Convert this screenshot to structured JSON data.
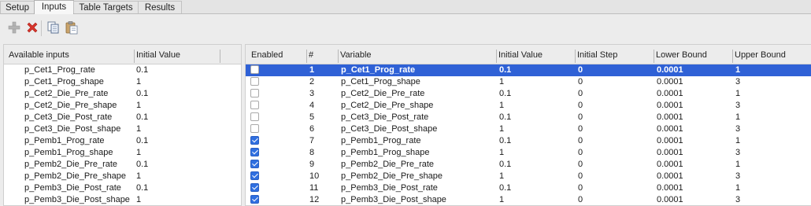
{
  "tabs": [
    "Setup",
    "Inputs",
    "Table Targets",
    "Results"
  ],
  "active_tab": "Inputs",
  "toolbar": {
    "icons": [
      "add-icon",
      "delete-icon",
      "copy-icon",
      "paste-icon"
    ]
  },
  "left_table": {
    "headers": [
      "Available inputs",
      "Initial Value",
      ""
    ],
    "rows": [
      {
        "name": "p_Cet1_Prog_rate",
        "value": "0.1"
      },
      {
        "name": "p_Cet1_Prog_shape",
        "value": "1"
      },
      {
        "name": "p_Cet2_Die_Pre_rate",
        "value": "0.1"
      },
      {
        "name": "p_Cet2_Die_Pre_shape",
        "value": "1"
      },
      {
        "name": "p_Cet3_Die_Post_rate",
        "value": "0.1"
      },
      {
        "name": "p_Cet3_Die_Post_shape",
        "value": "1"
      },
      {
        "name": "p_Pemb1_Prog_rate",
        "value": "0.1"
      },
      {
        "name": "p_Pemb1_Prog_shape",
        "value": "1"
      },
      {
        "name": "p_Pemb2_Die_Pre_rate",
        "value": "0.1"
      },
      {
        "name": "p_Pemb2_Die_Pre_shape",
        "value": "1"
      },
      {
        "name": "p_Pemb3_Die_Post_rate",
        "value": "0.1"
      },
      {
        "name": "p_Pemb3_Die_Post_shape",
        "value": "1"
      }
    ]
  },
  "right_table": {
    "headers": [
      "Enabled",
      "#",
      "Variable",
      "Initial Value",
      "Initial Step",
      "Lower Bound",
      "Upper Bound"
    ],
    "rows": [
      {
        "enabled": false,
        "num": "1",
        "variable": "p_Cet1_Prog_rate",
        "initial": "0.1",
        "step": "0",
        "lower": "0.0001",
        "upper": "1",
        "selected": true
      },
      {
        "enabled": false,
        "num": "2",
        "variable": "p_Cet1_Prog_shape",
        "initial": "1",
        "step": "0",
        "lower": "0.0001",
        "upper": "3"
      },
      {
        "enabled": false,
        "num": "3",
        "variable": "p_Cet2_Die_Pre_rate",
        "initial": "0.1",
        "step": "0",
        "lower": "0.0001",
        "upper": "1"
      },
      {
        "enabled": false,
        "num": "4",
        "variable": "p_Cet2_Die_Pre_shape",
        "initial": "1",
        "step": "0",
        "lower": "0.0001",
        "upper": "3"
      },
      {
        "enabled": false,
        "num": "5",
        "variable": "p_Cet3_Die_Post_rate",
        "initial": "0.1",
        "step": "0",
        "lower": "0.0001",
        "upper": "1"
      },
      {
        "enabled": false,
        "num": "6",
        "variable": "p_Cet3_Die_Post_shape",
        "initial": "1",
        "step": "0",
        "lower": "0.0001",
        "upper": "3"
      },
      {
        "enabled": true,
        "num": "7",
        "variable": "p_Pemb1_Prog_rate",
        "initial": "0.1",
        "step": "0",
        "lower": "0.0001",
        "upper": "1"
      },
      {
        "enabled": true,
        "num": "8",
        "variable": "p_Pemb1_Prog_shape",
        "initial": "1",
        "step": "0",
        "lower": "0.0001",
        "upper": "3"
      },
      {
        "enabled": true,
        "num": "9",
        "variable": "p_Pemb2_Die_Pre_rate",
        "initial": "0.1",
        "step": "0",
        "lower": "0.0001",
        "upper": "1"
      },
      {
        "enabled": true,
        "num": "10",
        "variable": "p_Pemb2_Die_Pre_shape",
        "initial": "1",
        "step": "0",
        "lower": "0.0001",
        "upper": "3"
      },
      {
        "enabled": true,
        "num": "11",
        "variable": "p_Pemb3_Die_Post_rate",
        "initial": "0.1",
        "step": "0",
        "lower": "0.0001",
        "upper": "1"
      },
      {
        "enabled": true,
        "num": "12",
        "variable": "p_Pemb3_Die_Post_shape",
        "initial": "1",
        "step": "0",
        "lower": "0.0001",
        "upper": "3"
      }
    ]
  }
}
